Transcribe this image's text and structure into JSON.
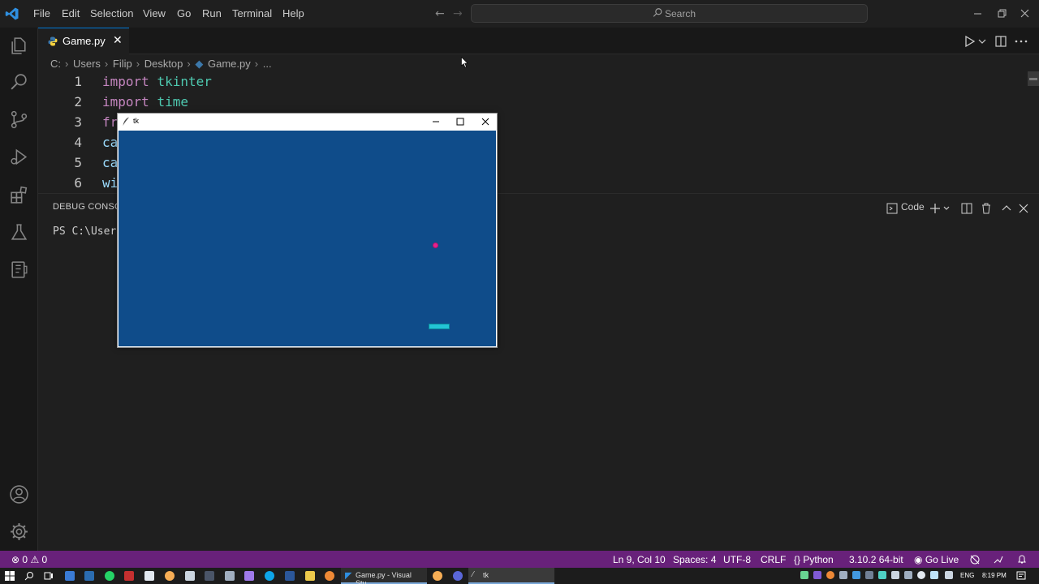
{
  "menu": [
    "File",
    "Edit",
    "Selection",
    "View",
    "Go",
    "Run",
    "Terminal",
    "Help"
  ],
  "search": {
    "placeholder": "Search"
  },
  "tab": {
    "label": "Game.py",
    "close": "✕"
  },
  "breadcrumb": [
    "C:",
    "Users",
    "Filip",
    "Desktop",
    "Game.py",
    "..."
  ],
  "editor": {
    "lines": [
      {
        "n": "1",
        "parts": [
          [
            "kw",
            "import"
          ],
          [
            "sp",
            " "
          ],
          [
            "mod",
            "tkinter"
          ]
        ]
      },
      {
        "n": "2",
        "parts": [
          [
            "kw",
            "import"
          ],
          [
            "sp",
            " "
          ],
          [
            "mod",
            "time"
          ]
        ]
      },
      {
        "n": "3",
        "parts": [
          [
            "kw",
            "fr"
          ]
        ]
      },
      {
        "n": "4",
        "parts": [
          [
            "idn",
            "ca"
          ]
        ]
      },
      {
        "n": "5",
        "parts": [
          [
            "idn",
            "ca"
          ]
        ]
      },
      {
        "n": "6",
        "parts": [
          [
            "idn",
            "wi"
          ]
        ]
      }
    ]
  },
  "panel": {
    "title": "DEBUG CONSOLE",
    "terminal_text": "PS C:\\Users",
    "code_label": "Code"
  },
  "tk": {
    "title": "tk",
    "canvas_color": "#0f4c8a",
    "ball_color": "#e3238f",
    "paddle_color": "#23c5d6"
  },
  "status": {
    "errors": "0",
    "warnings": "0",
    "cursor": "Ln 9, Col 10",
    "spaces": "Spaces: 4",
    "encoding": "UTF-8",
    "eol": "CRLF",
    "language": "Python",
    "interpreter": "3.10.2 64-bit",
    "golive": "Go Live"
  },
  "taskbar": {
    "vscode_label": "Game.py - Visual Stu...",
    "tk_label": "tk",
    "lang": "ENG",
    "time": "8:19 PM"
  },
  "colors": {
    "statusbar": "#68217a",
    "accent": "#0078d4"
  }
}
